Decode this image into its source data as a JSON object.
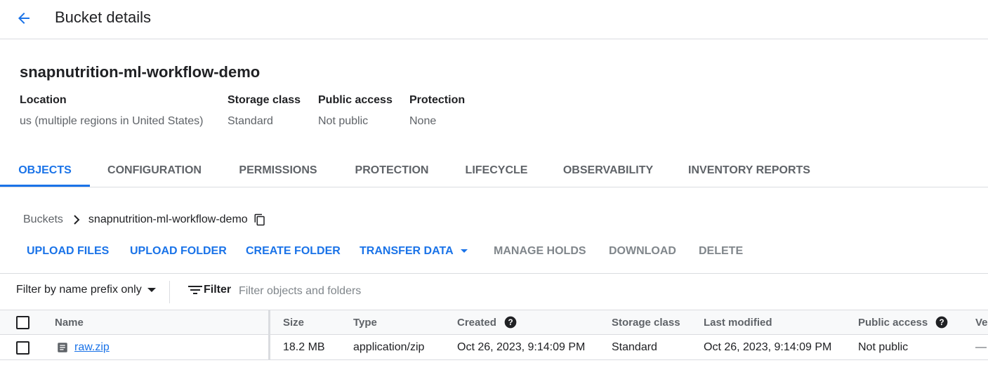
{
  "header": {
    "title": "Bucket details"
  },
  "bucket": {
    "name": "snapnutrition-ml-workflow-demo",
    "meta": [
      {
        "label": "Location",
        "value": "us (multiple regions in United States)"
      },
      {
        "label": "Storage class",
        "value": "Standard"
      },
      {
        "label": "Public access",
        "value": "Not public"
      },
      {
        "label": "Protection",
        "value": "None"
      }
    ]
  },
  "tabs": [
    {
      "label": "OBJECTS",
      "active": true
    },
    {
      "label": "CONFIGURATION"
    },
    {
      "label": "PERMISSIONS"
    },
    {
      "label": "PROTECTION"
    },
    {
      "label": "LIFECYCLE"
    },
    {
      "label": "OBSERVABILITY"
    },
    {
      "label": "INVENTORY REPORTS"
    }
  ],
  "breadcrumb": {
    "root": "Buckets",
    "current": "snapnutrition-ml-workflow-demo"
  },
  "actions": {
    "upload_files": "UPLOAD FILES",
    "upload_folder": "UPLOAD FOLDER",
    "create_folder": "CREATE FOLDER",
    "transfer_data": "TRANSFER DATA",
    "manage_holds": "MANAGE HOLDS",
    "download": "DOWNLOAD",
    "delete": "DELETE"
  },
  "filter": {
    "mode": "Filter by name prefix only",
    "button": "Filter",
    "placeholder": "Filter objects and folders"
  },
  "table": {
    "columns": {
      "name": "Name",
      "size": "Size",
      "type": "Type",
      "created": "Created",
      "storage_class": "Storage class",
      "last_modified": "Last modified",
      "public_access": "Public access",
      "version": "Ve"
    },
    "rows": [
      {
        "name": "raw.zip",
        "size": "18.2 MB",
        "type": "application/zip",
        "created": "Oct 26, 2023, 9:14:09 PM",
        "storage_class": "Standard",
        "last_modified": "Oct 26, 2023, 9:14:09 PM",
        "public_access": "Not public",
        "version": "—"
      }
    ]
  },
  "colors": {
    "accent": "#1a73e8",
    "text": "#202124",
    "muted": "#5f6368",
    "disabled": "#80868b",
    "border": "#dadce0"
  },
  "icons": [
    "arrow-back-icon",
    "chevron-right-icon",
    "copy-icon",
    "dropdown-arrow-icon",
    "filter-list-icon",
    "help-circle-icon",
    "file-document-icon"
  ]
}
